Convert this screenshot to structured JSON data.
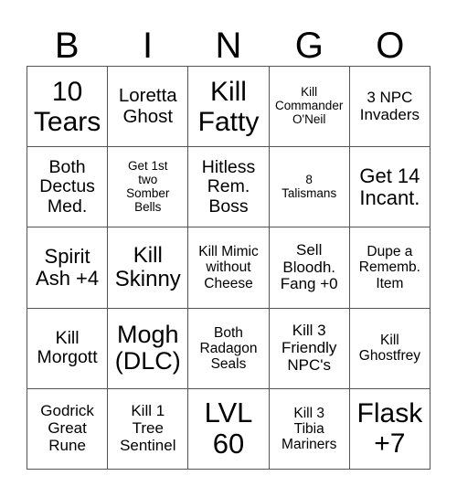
{
  "header": {
    "letters": [
      "B",
      "I",
      "N",
      "G",
      "O"
    ]
  },
  "cells": [
    [
      "10\nTears",
      "Loretta\nGhost",
      "Kill\nFatty",
      "Kill\nCommander\nO'Neil",
      "3 NPC\nInvaders"
    ],
    [
      "Both\nDectus\nMed.",
      "Get 1st\ntwo\nSomber\nBells",
      "Hitless\nRem.\nBoss",
      "8\nTalismans",
      "Get 14\nIncant."
    ],
    [
      "Spirit\nAsh +4",
      "Kill\nSkinny",
      "Kill Mimic\nwithout\nCheese",
      "Sell\nBloodh.\nFang +0",
      "Dupe a\nRememb.\nItem"
    ],
    [
      "Kill\nMorgott",
      "Mogh\n(DLC)",
      "Both\nRadagon\nSeals",
      "Kill 3\nFriendly\nNPC's",
      "Kill\nGhostfrey"
    ],
    [
      "Godrick\nGreat\nRune",
      "Kill 1\nTree\nSentinel",
      "LVL\n60",
      "Kill 3\nTibia\nMariners",
      "Flask\n+7"
    ]
  ]
}
